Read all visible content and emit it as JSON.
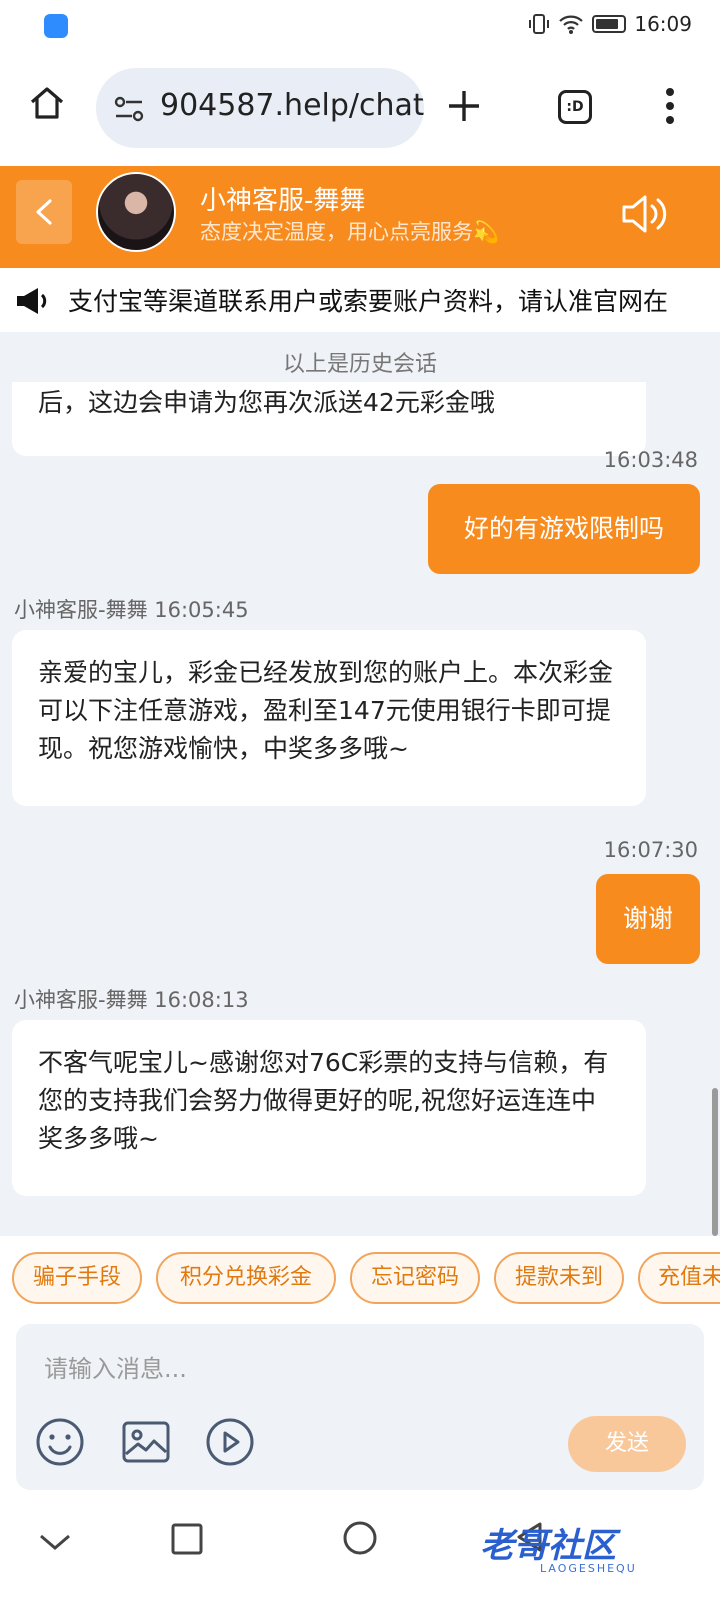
{
  "status": {
    "time": "16:09"
  },
  "browser": {
    "url": "904587.help/chat",
    "tabs_label": ":D"
  },
  "header": {
    "agent_name": "小神客服-舞舞",
    "motto": "态度决定温度，用心点亮服务💫"
  },
  "notice": {
    "text": "支付宝等渠道联系用户或索要账户资料，请认准官网在"
  },
  "chat": {
    "history_note": "以上是历史会话",
    "partial_message": "后，这边会申请为您再次派送42元彩金哦",
    "messages": [
      {
        "time": "16:03:48",
        "text": "好的有游戏限制吗"
      },
      {
        "meta": "小神客服-舞舞 16:05:45",
        "text": "亲爱的宝儿，彩金已经发放到您的账户上。本次彩金可以下注任意游戏，盈利至147元使用银行卡即可提现。祝您游戏愉快，中奖多多哦~"
      },
      {
        "time": "16:07:30",
        "text": "谢谢"
      },
      {
        "meta": "小神客服-舞舞 16:08:13",
        "text": "不客气呢宝儿~感谢您对76C彩票的支持与信赖，有您的支持我们会努力做得更好的呢,祝您好运连连中奖多多哦~"
      }
    ]
  },
  "quick_replies": [
    "骗子手段",
    "积分兑换彩金",
    "忘记密码",
    "提款未到",
    "充值未到"
  ],
  "composer": {
    "placeholder": "请输入消息...",
    "send_label": "发送"
  },
  "watermark": {
    "title": "老哥社区",
    "subtitle": "LAOGESHEQU"
  },
  "colors": {
    "accent": "#f78b1e",
    "chat_bg": "#eff2f6",
    "chip_text": "#e07a10",
    "send_disabled": "#f8c89a"
  }
}
